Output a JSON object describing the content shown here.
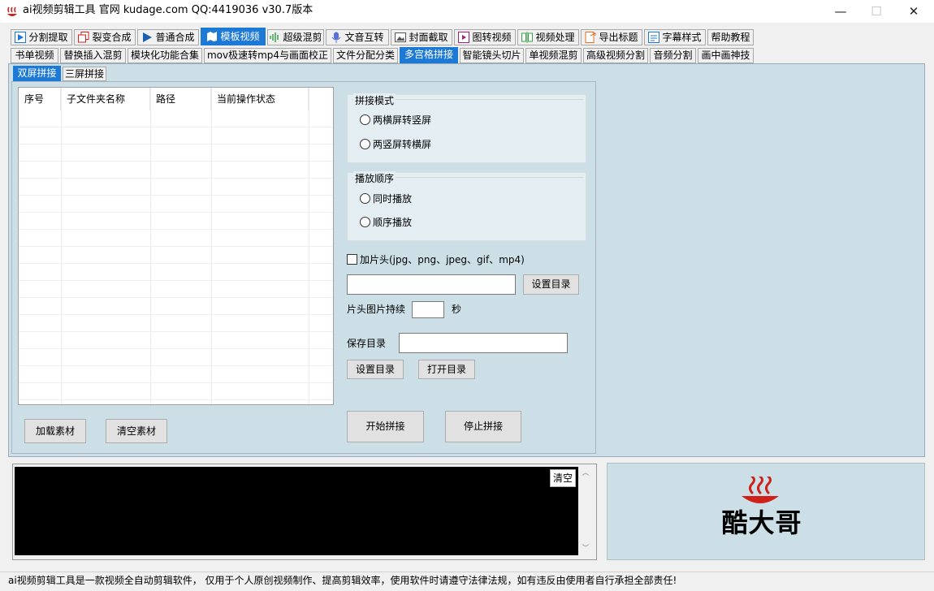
{
  "window": {
    "title": "ai视频剪辑工具 官网 kudage.com QQ:4419036   v30.7版本",
    "minimize": "—",
    "maximize": "☐",
    "close": "✕"
  },
  "main_tabs": [
    {
      "label": "分割提取",
      "icon": "play-icon",
      "color": "#1c79d6"
    },
    {
      "label": "裂变合成",
      "icon": "layers-icon",
      "color": "#d0201a"
    },
    {
      "label": "普通合成",
      "icon": "play-icon",
      "color": "#1c5fb0"
    },
    {
      "label": "模板视频",
      "icon": "map-icon",
      "color": "#ffffff"
    },
    {
      "label": "超级混剪",
      "icon": "sound-wave-icon",
      "color": "#3aa34a"
    },
    {
      "label": "文音互转",
      "icon": "microphone-icon",
      "color": "#5a6fd8"
    },
    {
      "label": "封面截取",
      "icon": "image-icon",
      "color": "#555555"
    },
    {
      "label": "图转视频",
      "icon": "play-frame-icon",
      "color": "#a0207a"
    },
    {
      "label": "视频处理",
      "icon": "split-icon",
      "color": "#3aa34a"
    },
    {
      "label": "导出标题",
      "icon": "export-doc-icon",
      "color": "#e07020"
    },
    {
      "label": "字幕样式",
      "icon": "subtitle-icon",
      "color": "#1c79d6"
    },
    {
      "label": "帮助教程",
      "icon": "",
      "color": ""
    }
  ],
  "sub_tabs": [
    "书单视频",
    "替换插入混剪",
    "模块化功能合集",
    "mov极速转mp4与画面校正",
    "文件分配分类",
    "多宫格拼接",
    "智能镜头切片",
    "单视频混剪",
    "高级视频分割",
    "音频分割",
    "画中画神技"
  ],
  "inner_tabs": [
    "双屏拼接",
    "三屏拼接"
  ],
  "grid": {
    "columns": [
      "序号",
      "子文件夹名称",
      "路径",
      "当前操作状态"
    ]
  },
  "buttons": {
    "load": "加载素材",
    "clear_material": "清空素材",
    "set_dir_1": "设置目录",
    "set_dir_2": "设置目录",
    "open_dir": "打开目录",
    "start": "开始拼接",
    "stop": "停止拼接",
    "clear_log": "清空"
  },
  "splice_mode": {
    "label": "拼接模式",
    "options": [
      "两横屏转竖屏",
      "两竖屏转横屏"
    ]
  },
  "play_order": {
    "label": "播放顺序",
    "options": [
      "同时播放",
      "顺序播放"
    ]
  },
  "intro": {
    "checkbox_label": "加片头(jpg、png、jpeg、gif、mp4)",
    "path_value": "",
    "duration_label": "片头图片持续",
    "duration_value": "",
    "duration_unit": "秒"
  },
  "save": {
    "label": "保存目录",
    "value": ""
  },
  "logo": {
    "text": "酷大哥",
    "accent": "#d0201a"
  },
  "status": "ai视频剪辑工具是一款视频全自动剪辑软件，  仅用于个人原创视频制作、提高剪辑效率，使用软件时请遵守法律法规，如有违反由使用者自行承担全部责任!"
}
